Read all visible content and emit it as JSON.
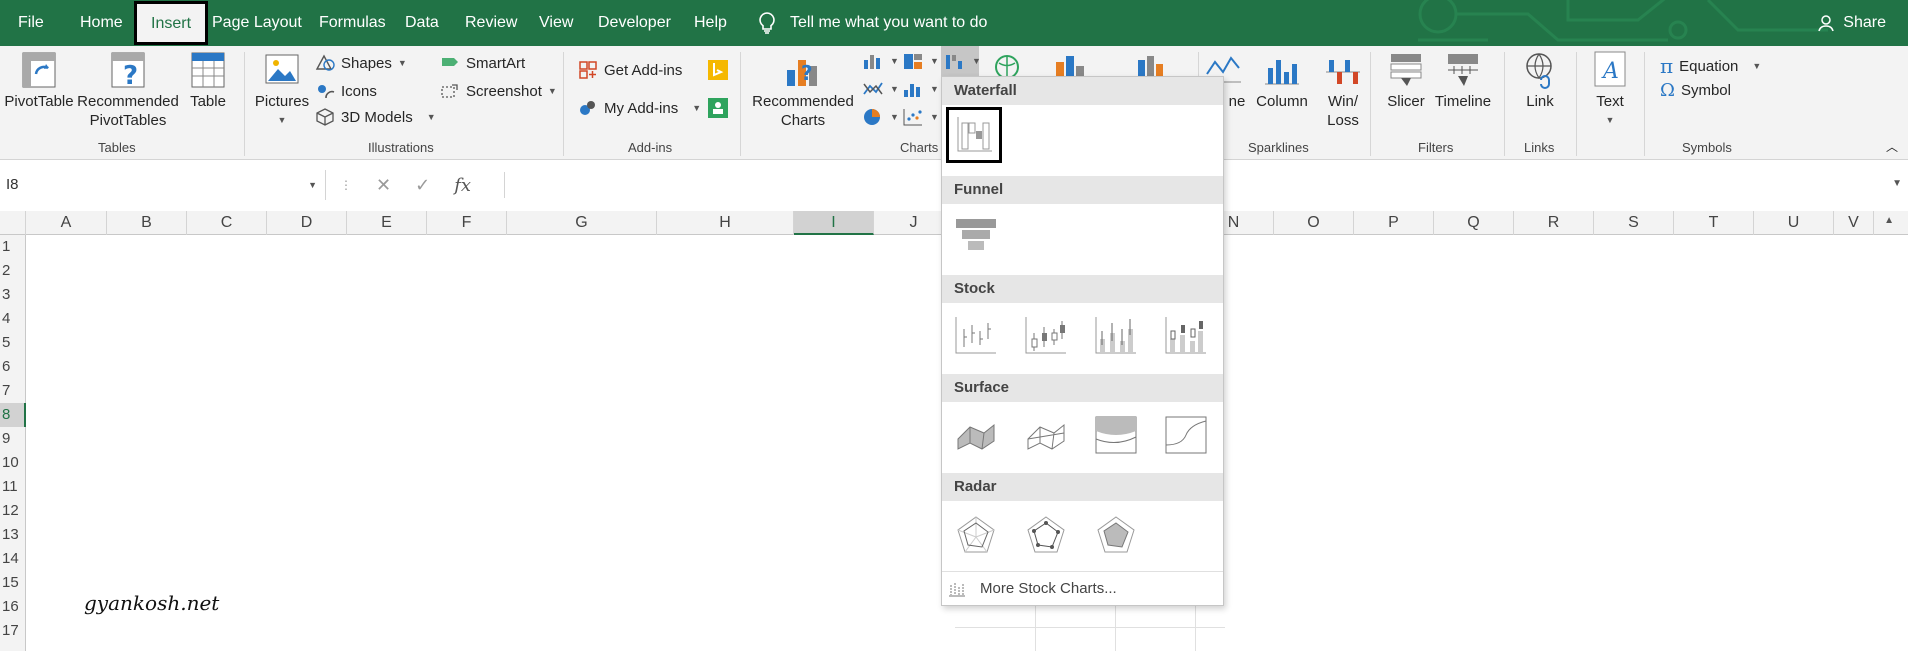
{
  "colors": {
    "brand_green": "#217346",
    "ribbon_bg": "#f3f3f3",
    "selection_outline": "#000000"
  },
  "tabs": [
    {
      "label": "File"
    },
    {
      "label": "Home"
    },
    {
      "label": "Insert"
    },
    {
      "label": "Page Layout"
    },
    {
      "label": "Formulas"
    },
    {
      "label": "Data"
    },
    {
      "label": "Review"
    },
    {
      "label": "View"
    },
    {
      "label": "Developer"
    },
    {
      "label": "Help"
    }
  ],
  "active_tab": "Insert",
  "tell_me": "Tell me what you want to do",
  "share_label": "Share",
  "ribbon": {
    "tables": {
      "label": "Tables",
      "pivot_table": "PivotTable",
      "recommended_pivot_1": "Recommended",
      "recommended_pivot_2": "PivotTables",
      "table": "Table"
    },
    "illustrations": {
      "label": "Illustrations",
      "pictures": "Pictures",
      "shapes": "Shapes",
      "icons": "Icons",
      "models_3d": "3D Models",
      "smartart": "SmartArt",
      "screenshot": "Screenshot"
    },
    "addins": {
      "label": "Add-ins",
      "get_addins": "Get Add-ins",
      "my_addins": "My Add-ins"
    },
    "charts": {
      "label": "Charts",
      "recommended_1": "Recommended",
      "recommended_2": "Charts"
    },
    "sparklines": {
      "label": "Sparklines",
      "line_partial": "ne",
      "column": "Column",
      "winloss_1": "Win/",
      "winloss_2": "Loss"
    },
    "filters": {
      "label": "Filters",
      "slicer": "Slicer",
      "timeline": "Timeline"
    },
    "links": {
      "label": "Links",
      "link": "Link"
    },
    "text": {
      "text": "Text"
    },
    "symbols": {
      "label": "Symbols",
      "equation": "Equation",
      "symbol": "Symbol"
    }
  },
  "formula_bar": {
    "name_box": "I8",
    "cancel_glyph": "✕",
    "enter_glyph": "✓",
    "fx": "fx",
    "value": ""
  },
  "columns": [
    "A",
    "B",
    "C",
    "D",
    "E",
    "F",
    "G",
    "H",
    "I",
    "J",
    "N",
    "O",
    "P",
    "Q",
    "R",
    "S",
    "T",
    "U",
    "V"
  ],
  "selected_column": "I",
  "rows": [
    "1",
    "2",
    "3",
    "4",
    "5",
    "6",
    "7",
    "8",
    "9",
    "10",
    "11",
    "12",
    "13",
    "14",
    "15",
    "16",
    "17"
  ],
  "selected_row": "8",
  "watermark": "gyankosh.net",
  "dropdown": {
    "waterfall": "Waterfall",
    "funnel": "Funnel",
    "stock": "Stock",
    "surface": "Surface",
    "radar": "Radar",
    "more": "More Stock Charts..."
  }
}
